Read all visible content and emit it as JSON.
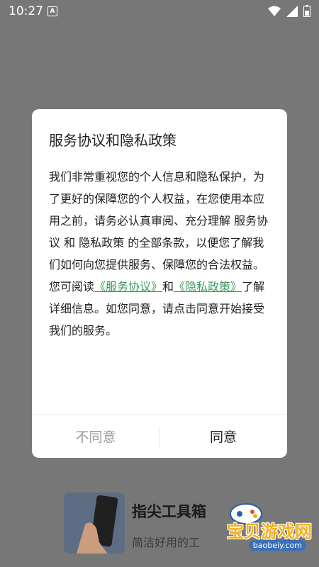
{
  "status_bar": {
    "time": "10:27",
    "a_badge": "A",
    "icons": [
      "wifi-icon",
      "signal-icon",
      "battery-icon"
    ]
  },
  "background_app": {
    "title": "指尖工具箱",
    "subtitle": "简洁好用的工",
    "watermark_text": "宝贝游戏网",
    "watermark_url": "baobeiy.com"
  },
  "dialog": {
    "title": "服务协议和隐私政策",
    "body_part1": "我们非常重视您的个人信息和隐私保护，为了更好的保障您的个人权益，在您使用本应用之前，请务必认真审阅、充分理解 服务协议 和 隐私政策 的全部条款，以便您了解我们如何向您提供服务、保障您的合法权益。您可阅读",
    "link_service": "《服务协议》",
    "body_and": "和",
    "link_privacy": "《隐私政策》",
    "body_part2": "了解详细信息。如您同意，请点击同意开始接受我们的服务。",
    "disagree_label": "不同意",
    "agree_label": "同意",
    "link_color": "#3a9a5a"
  }
}
